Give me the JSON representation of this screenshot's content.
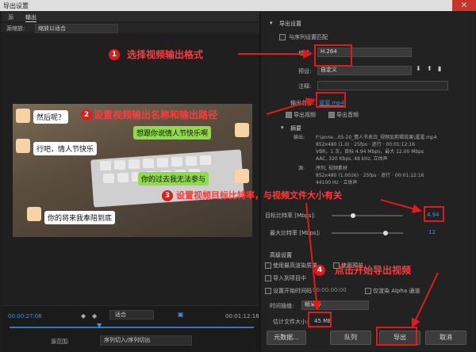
{
  "window": {
    "title": "导出设置",
    "close": "×"
  },
  "tabs": {
    "source": "源",
    "output": "输出"
  },
  "source_scale": {
    "label": "源缩放:",
    "value": "缩放以适合"
  },
  "preview": {
    "bubbles": {
      "b1": "然后呢？",
      "b2": "想跟你说情人节快乐啊",
      "b3": "行吧，情人节快乐",
      "b4": "你的过去我无法参与",
      "b5": "你的将来我奉陪到底"
    }
  },
  "timeline": {
    "start_time": "00:00:27:06",
    "fit": "适合",
    "end_time": "00:01:12:16"
  },
  "source_range": {
    "label": "源范围:",
    "value": "序列切入/序列切出"
  },
  "export_settings": {
    "section_title": "导出设置",
    "match_sequence": "与序列设置匹配",
    "format_label": "格式:",
    "format_value": "H.264",
    "preset_label": "预设:",
    "preset_value": "自定义",
    "comment_label": "注释:",
    "output_name_label": "输出名称:",
    "output_name_value": "渥渥.mp4",
    "export_video": "导出视频",
    "export_audio": "导出音频"
  },
  "summary": {
    "title": "摘要",
    "output_label": "输出:",
    "output_lines": [
      "F:\\anne...05-20_情人节表白_视频加剪辑效果\\渥渥.mp4",
      "852x480 (1.0) · 25fps · 逐行 · 00:01:12:16",
      "VBR，1 次，目标 4.94 Mbps，最大 12.00 Mbps",
      "AAC, 320 Kbps, 48 kHz, 立体声"
    ],
    "source_label": "源:",
    "source_lines": [
      "序列, 视频素材",
      "852x480 (1.0016) · 25fps · 逐行 · 00:01:12:16",
      "44100 Hz · 立体声"
    ]
  },
  "bitrate": {
    "target_label": "目标比特率 [Mbps]:",
    "target_value": "4.94",
    "target_fraction": 0.3,
    "max_label": "最大比特率 [Mbps]:",
    "max_value": "12",
    "max_fraction": 0.75
  },
  "advanced": {
    "title": "高级设置",
    "max_render_quality": "使用最高渲染质量",
    "use_previews": "使用预览",
    "import_project": "导入到项目中",
    "set_start_timecode": "设置开始时间码",
    "timecode_value": "00:00:00:00",
    "render_alpha": "仅渲染 Alpha 通道",
    "interp_label": "时间插值:",
    "interp_value": "帧采样",
    "est_size_label": "估计文件大小:",
    "est_size_value": "45 MB"
  },
  "buttons": {
    "metadata": "元数据...",
    "queue": "队列",
    "export": "导出",
    "cancel": "取消"
  },
  "annotations": {
    "step1": {
      "num": "1",
      "text": "选择视频输出格式"
    },
    "step2": {
      "num": "2",
      "text": "设置视频输出名称和输出路径"
    },
    "step3": {
      "num": "3",
      "text": "设置视频目标比特率，与视频文件大小有关"
    },
    "step4": {
      "num": "4",
      "text": "点击开始导出视频"
    }
  },
  "colors": {
    "accent_blue": "#4d8fd8",
    "annotation_red": "#e21a1a"
  }
}
